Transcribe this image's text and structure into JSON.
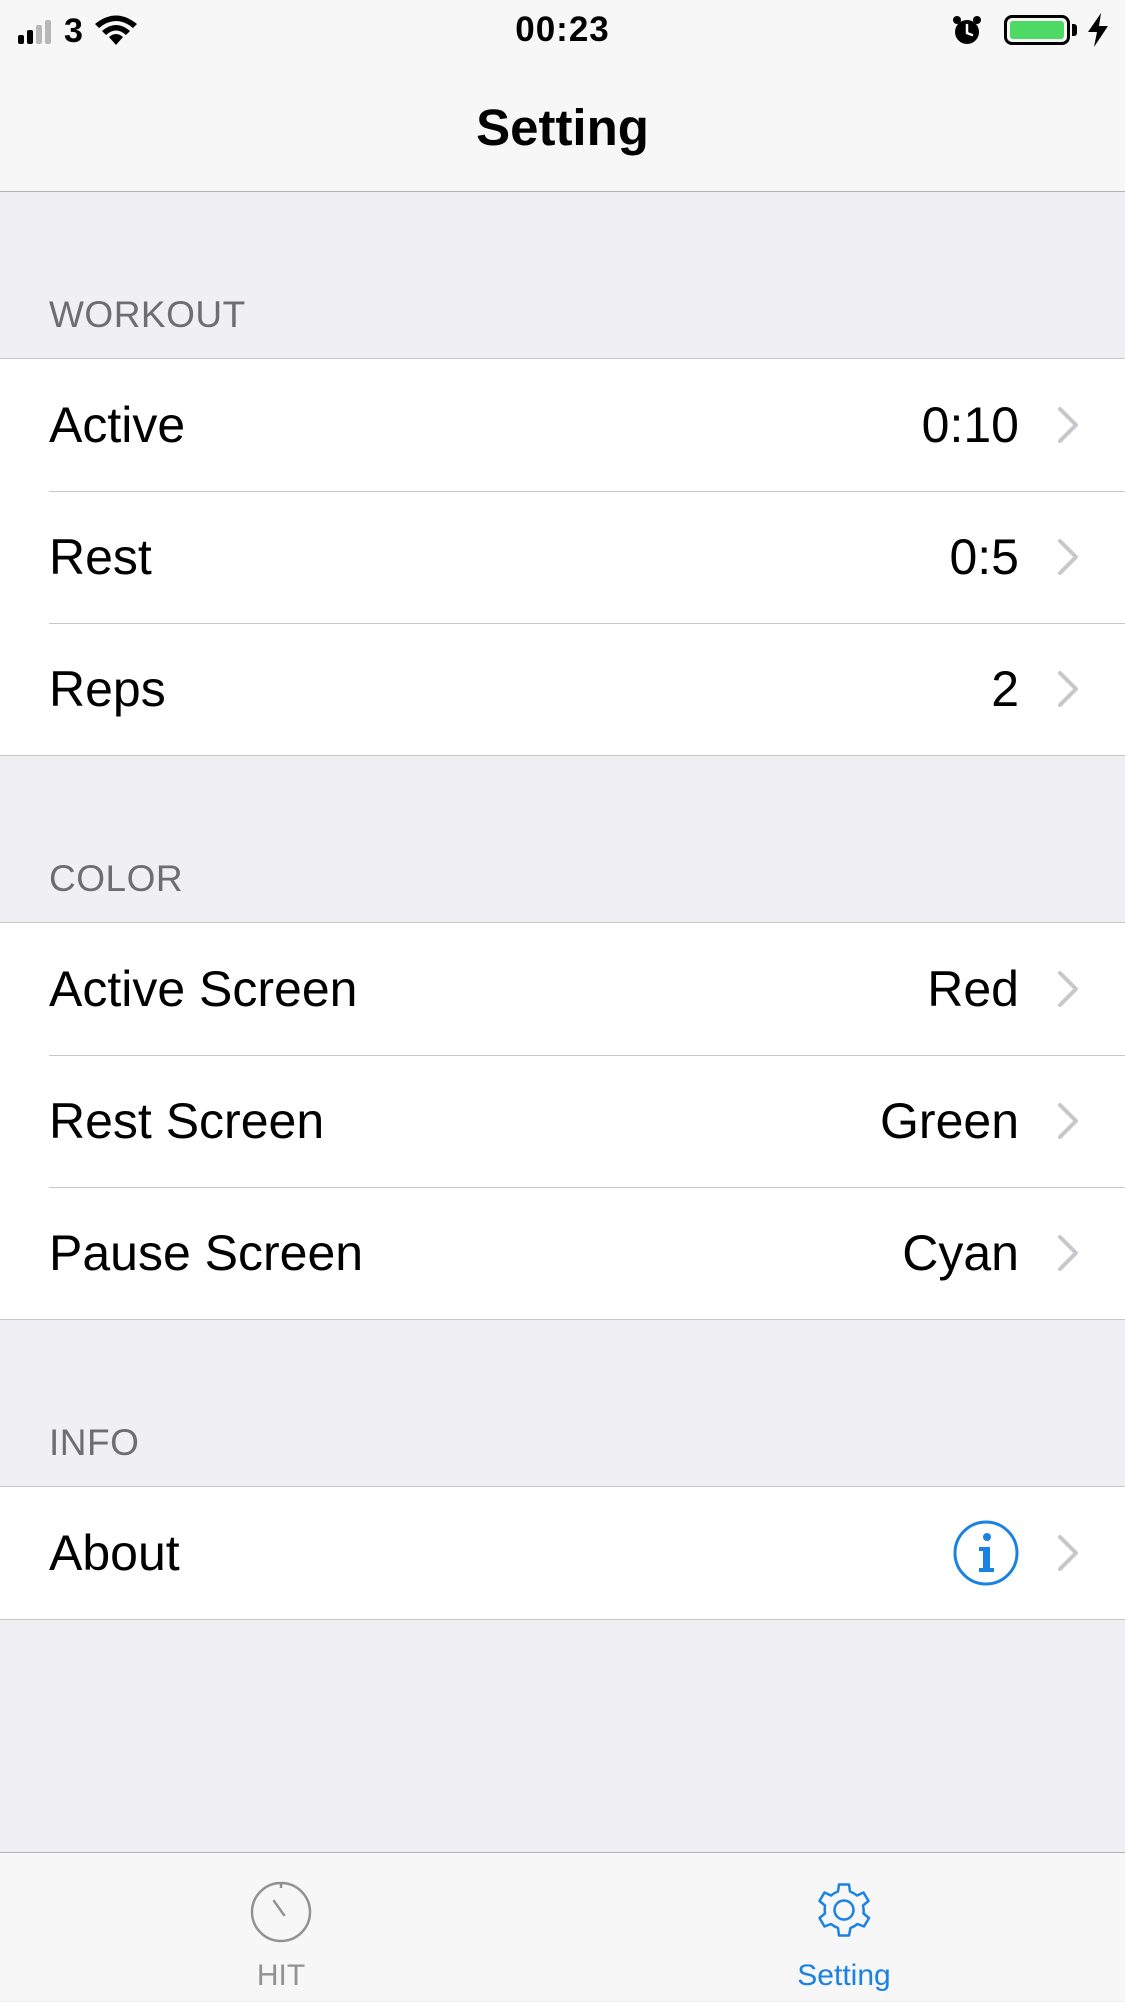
{
  "status_bar": {
    "carrier": "3",
    "time": "00:23",
    "battery_color": "#4cd964"
  },
  "nav": {
    "title": "Setting"
  },
  "sections": {
    "workout": {
      "header": "WORKOUT",
      "rows": [
        {
          "label": "Active",
          "value": "0:10"
        },
        {
          "label": "Rest",
          "value": "0:5"
        },
        {
          "label": "Reps",
          "value": "2"
        }
      ]
    },
    "color": {
      "header": "COLOR",
      "rows": [
        {
          "label": "Active Screen",
          "value": "Red"
        },
        {
          "label": "Rest Screen",
          "value": "Green"
        },
        {
          "label": "Pause Screen",
          "value": "Cyan"
        }
      ]
    },
    "info": {
      "header": "INFO",
      "rows": [
        {
          "label": "About",
          "icon": "info-icon"
        }
      ]
    }
  },
  "tab_bar": {
    "tabs": [
      {
        "label": "HIT",
        "icon": "stopwatch-icon",
        "selected": false
      },
      {
        "label": "Setting",
        "icon": "gear-icon",
        "selected": true
      }
    ]
  },
  "colors": {
    "accent": "#1a82e2",
    "inactive": "#929292",
    "background": "#efeff4"
  }
}
